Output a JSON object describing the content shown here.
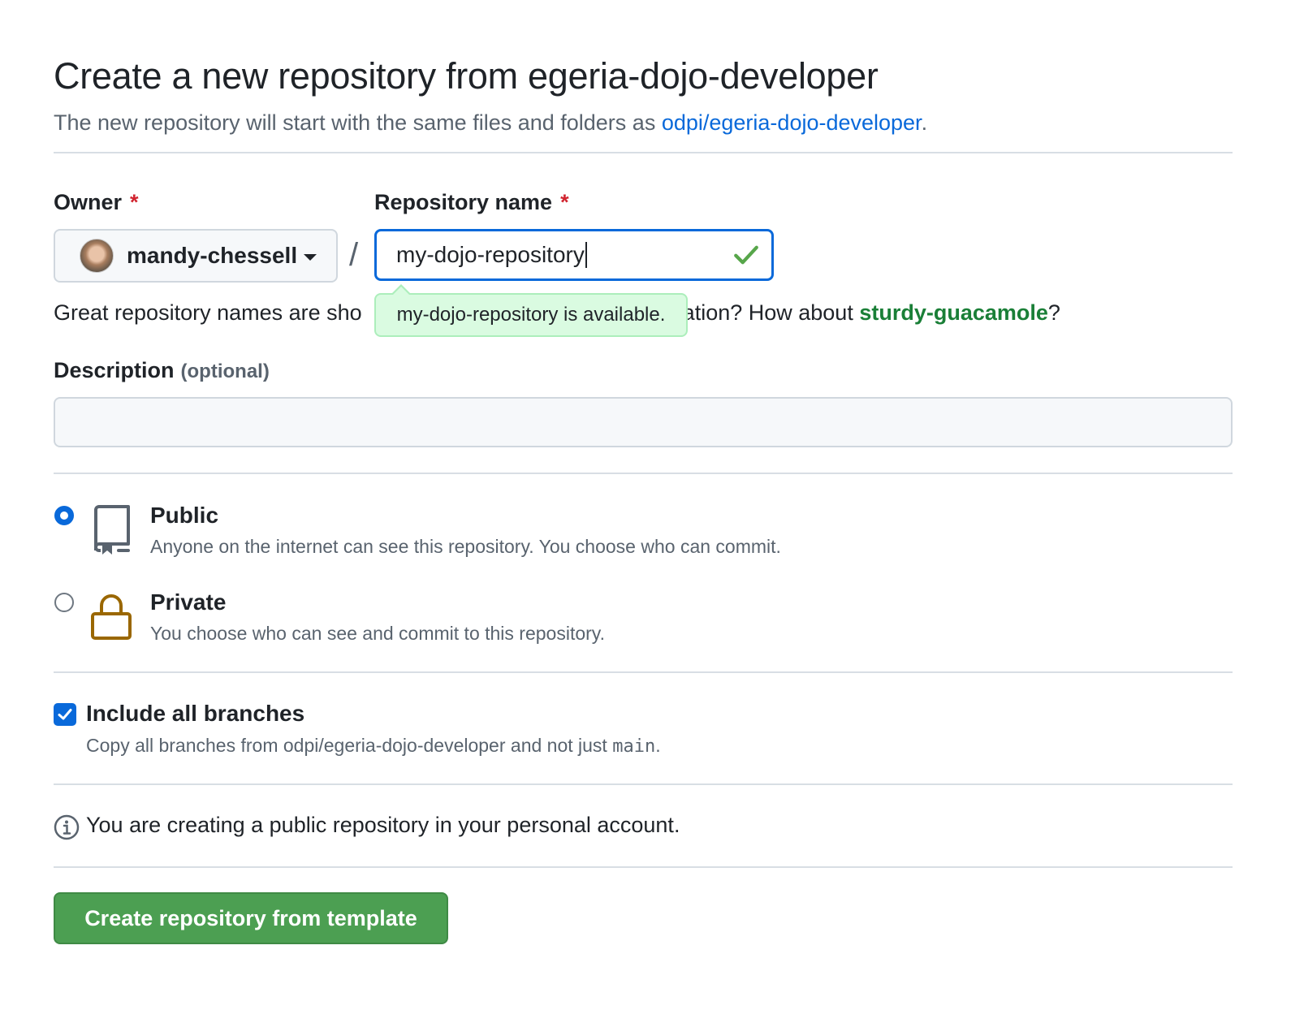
{
  "header": {
    "title": "Create a new repository from egeria-dojo-developer",
    "subtitle_prefix": "The new repository will start with the same files and folders as ",
    "template_link": "odpi/egeria-dojo-developer",
    "subtitle_suffix": "."
  },
  "owner": {
    "label": "Owner",
    "required_mark": "*",
    "value": "mandy-chessell"
  },
  "separator": "/",
  "repo_name": {
    "label": "Repository name",
    "required_mark": "*",
    "value": "my-dojo-repository",
    "availability": "my-dojo-repository is available."
  },
  "hint": {
    "prefix": "Great repository names are sho",
    "suffix": "ration? How about ",
    "suggestion": "sturdy-guacamole",
    "end": "?"
  },
  "description": {
    "label": "Description",
    "optional": "(optional)",
    "value": ""
  },
  "visibility": {
    "selected": "Public",
    "options": [
      {
        "title": "Public",
        "description": "Anyone on the internet can see this repository. You choose who can commit.",
        "icon": "repo-icon"
      },
      {
        "title": "Private",
        "description": "You choose who can see and commit to this repository.",
        "icon": "lock-icon"
      }
    ]
  },
  "branches": {
    "label": "Include all branches",
    "checked": true,
    "description_prefix": "Copy all branches from odpi/egeria-dojo-developer and not just ",
    "branch": "main",
    "description_suffix": "."
  },
  "info": {
    "icon": "info-icon",
    "text": "You are creating a public repository in your personal account."
  },
  "submit": {
    "label": "Create repository from template"
  },
  "colors": {
    "link": "#0969da",
    "success": "#1a7f37",
    "button_green": "#4c9f52",
    "lock_brown": "#9a6700"
  }
}
